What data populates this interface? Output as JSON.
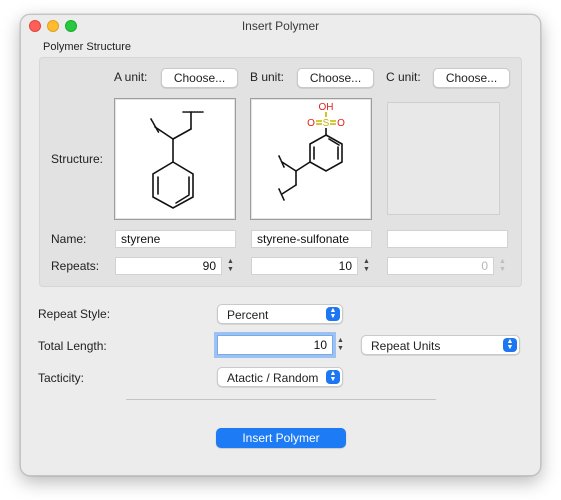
{
  "window": {
    "title": "Insert Polymer"
  },
  "polymer_structure": {
    "group_label": "Polymer Structure",
    "row_labels": {
      "structure": "Structure:",
      "name": "Name:",
      "repeats": "Repeats:"
    },
    "units": [
      {
        "label": "A unit:",
        "choose_label": "Choose...",
        "name": "styrene",
        "repeats": "90",
        "has_structure": true
      },
      {
        "label": "B unit:",
        "choose_label": "Choose...",
        "name": "styrene-sulfonate",
        "repeats": "10",
        "has_structure": true,
        "atom_labels": {
          "top": "OH",
          "left": "O",
          "center": "S",
          "right": "O"
        }
      },
      {
        "label": "C unit:",
        "choose_label": "Choose...",
        "name": "",
        "repeats": "0",
        "has_structure": false
      }
    ]
  },
  "repeat_style": {
    "label": "Repeat Style:",
    "value": "Percent"
  },
  "total_length": {
    "label": "Total Length:",
    "value": "10",
    "unit_value": "Repeat Units"
  },
  "tacticity": {
    "label": "Tacticity:",
    "value": "Atactic / Random"
  },
  "insert_button": {
    "label": "Insert Polymer"
  },
  "colors": {
    "accent": "#1d7bf6",
    "sulfur": "#c8b400",
    "oxygen": "#e0201b"
  }
}
